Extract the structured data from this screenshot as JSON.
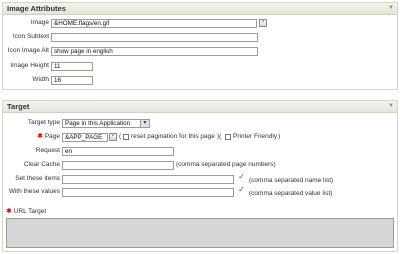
{
  "image_attributes": {
    "title": "Image Attributes",
    "fields": {
      "image": {
        "label": "Image",
        "value": "&HOME.flags/en.gif"
      },
      "icon_subtext": {
        "label": "Icon Subtext",
        "value": ""
      },
      "icon_image_alt": {
        "label": "Icon Image Alt",
        "value": "show page in english"
      },
      "image_height": {
        "label": "Image Height",
        "value": "11"
      },
      "width": {
        "label": "Width",
        "value": "16"
      }
    }
  },
  "target": {
    "title": "Target",
    "target_type": {
      "label": "Target type",
      "value": "Page in this Application"
    },
    "page": {
      "label": "Page",
      "value": "&APP_PAGE",
      "reset_label": "reset pagination for this page",
      "paren_open": "(",
      "paren_close": ")(",
      "printer_label": "Printer Friendly",
      "printer_close": ")"
    },
    "request": {
      "label": "Request",
      "value": "en"
    },
    "clear_cache": {
      "label": "Clear Cache",
      "value": "",
      "hint": "(comma separated page numbers)"
    },
    "set_items": {
      "label": "Set these items",
      "value": "",
      "hint": "(comma separated name list)"
    },
    "with_values": {
      "label": "With these values",
      "value": "",
      "hint": "(comma separated value list)"
    },
    "url_target": {
      "label": "URL Target"
    }
  },
  "colors": {
    "required": "#cc0000",
    "disabled_area": "#d6d6d6"
  }
}
